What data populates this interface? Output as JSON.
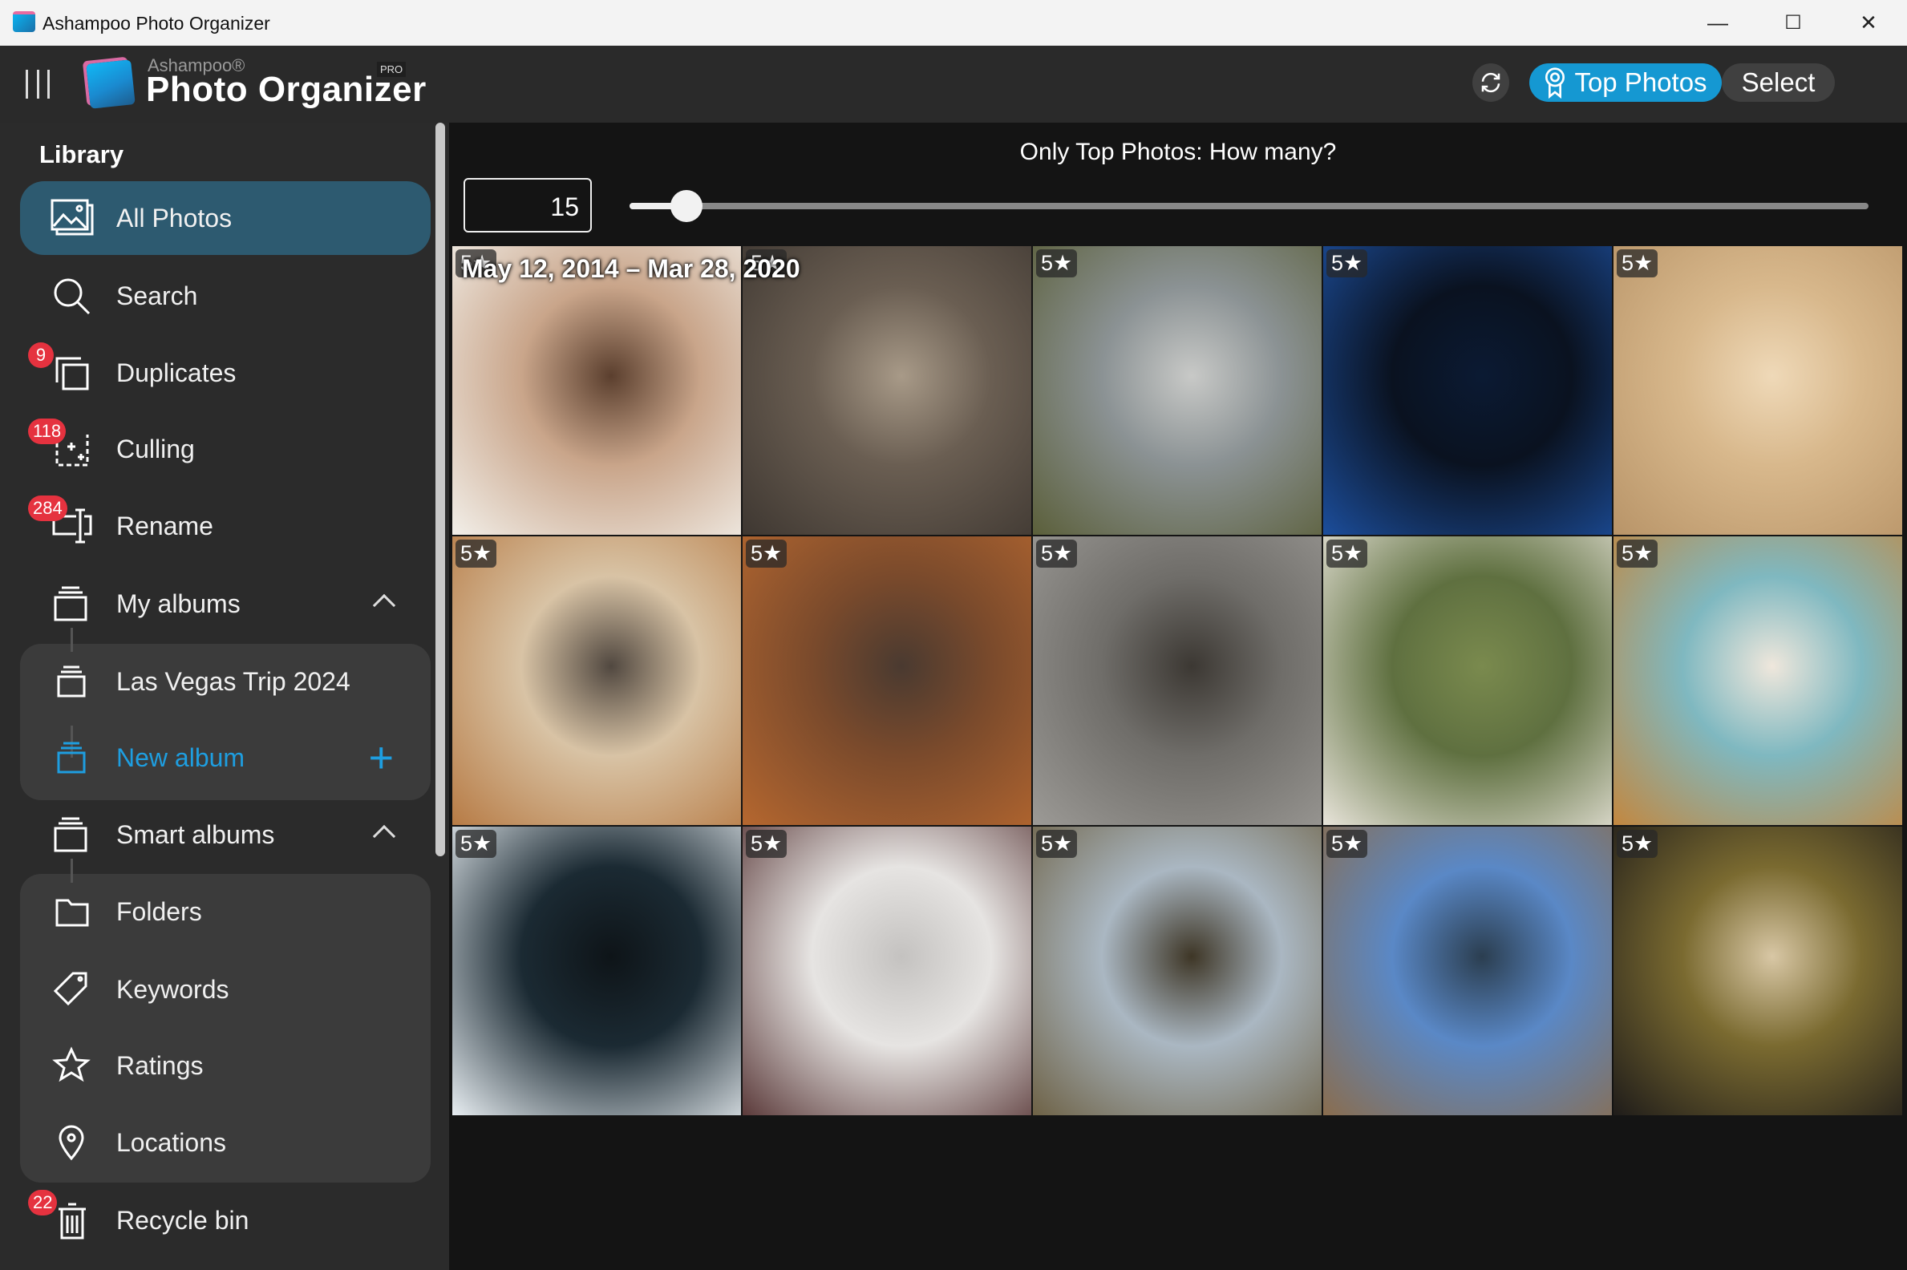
{
  "window": {
    "title": "Ashampoo Photo Organizer",
    "minimize": "—",
    "maximize": "☐",
    "close": "✕"
  },
  "header": {
    "brand_small": "Ashampoo®",
    "brand": "Photo Organizer",
    "edition": "PRO",
    "top_photos_label": "Top Photos",
    "select_label": "Select",
    "accent": "#1598d2"
  },
  "sidebar": {
    "section": "Library",
    "items": [
      {
        "label": "All Photos",
        "icon": "photos-icon",
        "active": true
      },
      {
        "label": "Search",
        "icon": "search-icon"
      },
      {
        "label": "Duplicates",
        "icon": "duplicates-icon",
        "badge": "9"
      },
      {
        "label": "Culling",
        "icon": "culling-icon",
        "badge": "118"
      },
      {
        "label": "Rename",
        "icon": "rename-icon",
        "badge": "284"
      },
      {
        "label": "My albums",
        "icon": "album-icon",
        "expanded": true
      },
      {
        "label": "Las Vegas Trip 2024",
        "icon": "album-icon"
      },
      {
        "label": "New album",
        "icon": "album-icon"
      },
      {
        "label": "Smart albums",
        "icon": "album-icon",
        "expanded": true
      },
      {
        "label": "Folders",
        "icon": "folder-icon"
      },
      {
        "label": "Keywords",
        "icon": "tag-icon"
      },
      {
        "label": "Ratings",
        "icon": "star-icon"
      },
      {
        "label": "Locations",
        "icon": "location-pin-icon"
      },
      {
        "label": "Recycle bin",
        "icon": "trash-icon",
        "badge": "22"
      }
    ]
  },
  "main": {
    "prompt": "Only Top Photos: How many?",
    "count_value": "15",
    "slider_value": 15,
    "slider_fraction": 0.046,
    "date_range": "May 12, 2014 – Mar 28, 2020",
    "photos": [
      {
        "rating": "5★",
        "colors": [
          "#c9a58a",
          "#f2efe9",
          "#5b3f2e"
        ]
      },
      {
        "rating": "5★",
        "colors": [
          "#6a5e52",
          "#3e3731",
          "#a89a88"
        ]
      },
      {
        "rating": "5★",
        "colors": [
          "#8b9294",
          "#5b5f3a",
          "#c8c9c7"
        ]
      },
      {
        "rating": "5★",
        "colors": [
          "#0a1220",
          "#1c4e9c",
          "#0b1a33"
        ]
      },
      {
        "rating": "5★",
        "colors": [
          "#d8b88c",
          "#b89468",
          "#efd9b8"
        ]
      },
      {
        "rating": "5★",
        "colors": [
          "#d8c3a5",
          "#b77b45",
          "#514840"
        ]
      },
      {
        "rating": "5★",
        "colors": [
          "#7a4a2c",
          "#b5672f",
          "#4a3a30"
        ]
      },
      {
        "rating": "5★",
        "colors": [
          "#6f6d69",
          "#9c9a96",
          "#3c3833"
        ]
      },
      {
        "rating": "5★",
        "colors": [
          "#5f7040",
          "#e8e4da",
          "#7a8a4e"
        ]
      },
      {
        "rating": "5★",
        "colors": [
          "#7fb8c0",
          "#c3873f",
          "#efe7dc"
        ]
      },
      {
        "rating": "5★",
        "colors": [
          "#1b2a33",
          "#e8eef2",
          "#0e1418"
        ]
      },
      {
        "rating": "5★",
        "colors": [
          "#e6e4e2",
          "#5b3a3a",
          "#c4c2c0"
        ]
      },
      {
        "rating": "5★",
        "colors": [
          "#aab7c2",
          "#6e6246",
          "#3e3626"
        ]
      },
      {
        "rating": "5★",
        "colors": [
          "#5a88c6",
          "#8a6d4e",
          "#2b3e50"
        ]
      },
      {
        "rating": "5★",
        "colors": [
          "#7a6a30",
          "#1f1c1a",
          "#d8c7a5"
        ]
      }
    ]
  }
}
